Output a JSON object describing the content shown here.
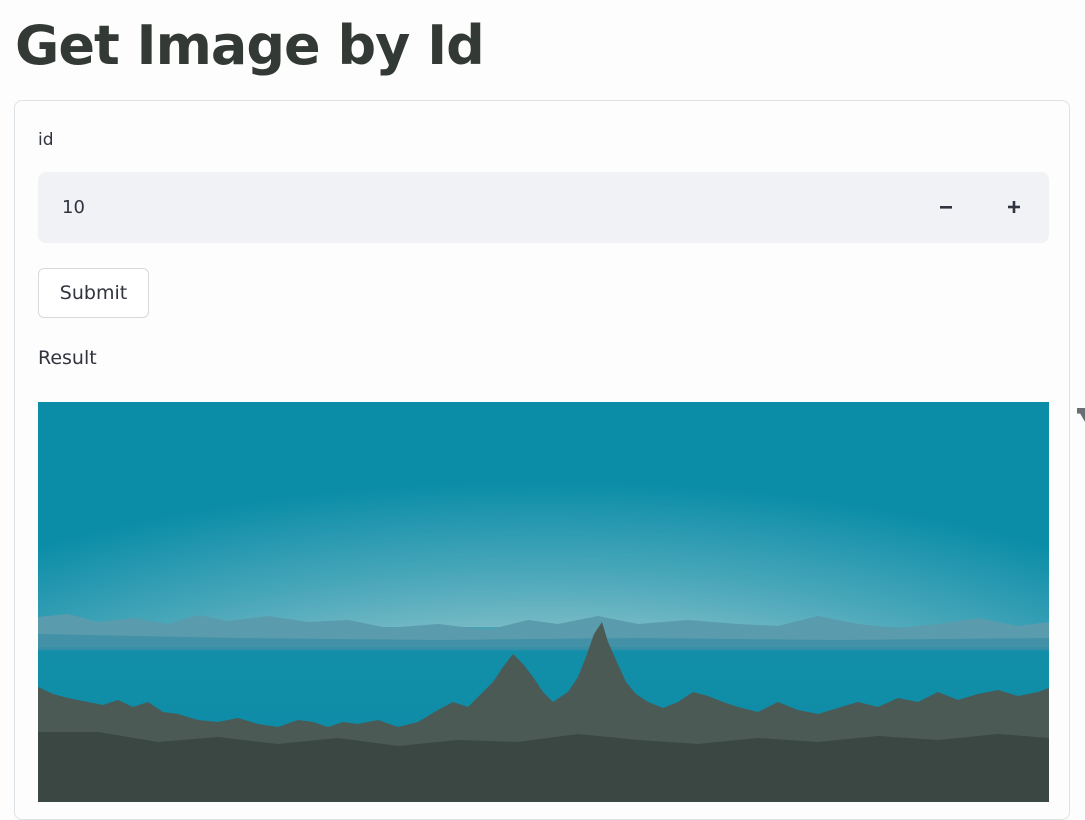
{
  "page": {
    "title": "Get Image by Id"
  },
  "form": {
    "field_label": "id",
    "id_value": "10",
    "decrement_symbol": "−",
    "increment_symbol": "+",
    "submit_label": "Submit",
    "result_label": "Result"
  },
  "result": {
    "image_description_icon": "landscape-photo"
  },
  "colors": {
    "background": "#fdfdfd",
    "text": "#31333f",
    "input_background": "#f0f2f6",
    "border": "#dde2e6",
    "sky_top": "#0b8da8",
    "sky_horizon": "#b7d5d6",
    "water": "#0b8da8",
    "trees": "#4a5a56"
  }
}
